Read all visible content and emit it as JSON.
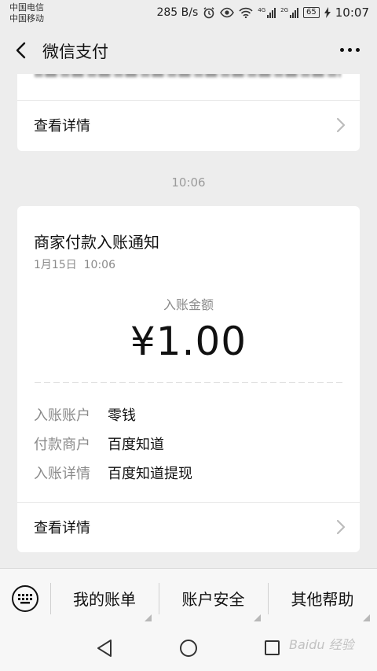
{
  "status_bar": {
    "carrier_1": "中国电信",
    "carrier_2": "中国移动",
    "speed": "285 B/s",
    "signal_1_label": "4G",
    "signal_2_label": "2G",
    "battery": "65",
    "time": "10:07"
  },
  "header": {
    "title": "微信支付"
  },
  "previous_card": {
    "detail_label": "查看详情"
  },
  "timestamp": "10:06",
  "notification": {
    "title": "商家付款入账通知",
    "date": "1月15日",
    "time": "10:06",
    "amount_label": "入账金额",
    "amount": "¥1.00",
    "fields": [
      {
        "key": "入账账户",
        "value": "零钱"
      },
      {
        "key": "付款商户",
        "value": "百度知道"
      },
      {
        "key": "入账详情",
        "value": "百度知道提现"
      }
    ],
    "detail_label": "查看详情"
  },
  "bottom_menu": {
    "items": [
      "我的账单",
      "账户安全",
      "其他帮助"
    ]
  },
  "watermark": "Baidu 经验"
}
